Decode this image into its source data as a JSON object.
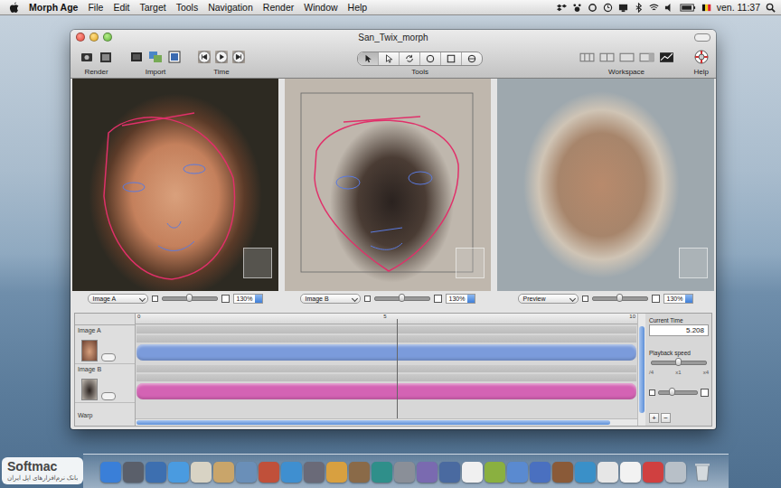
{
  "menubar": {
    "app": "Morph Age",
    "menus": [
      "File",
      "Edit",
      "Target",
      "Tools",
      "Navigation",
      "Render",
      "Window",
      "Help"
    ],
    "clock": "ven. 11:37"
  },
  "window": {
    "title": "San_Twix_morph"
  },
  "toolbar": {
    "labels": [
      "Render",
      "Import",
      "Time",
      "Tools",
      "Workspace",
      "Help"
    ],
    "tools": [
      {
        "kind": "select",
        "selected": true
      },
      {
        "kind": "direct",
        "selected": false
      },
      {
        "kind": "rotate",
        "selected": false
      },
      {
        "kind": "circle",
        "selected": false
      },
      {
        "kind": "square",
        "selected": false
      },
      {
        "kind": "morph",
        "selected": false
      }
    ]
  },
  "panes": [
    {
      "selector": "Image A",
      "zoom": "130%",
      "level": 0.5
    },
    {
      "selector": "Image B",
      "zoom": "130%",
      "level": 0.5
    },
    {
      "selector": "Preview",
      "zoom": "130%",
      "level": 0.5
    }
  ],
  "timeline": {
    "ruler": [
      "0",
      "5",
      "10"
    ],
    "playhead": 0.52,
    "tracks": [
      {
        "label": "Image A",
        "color": "#7b9bdb"
      },
      {
        "label": "Image B",
        "color": "#d463b4"
      }
    ],
    "extra_label": "Warp",
    "current_time_label": "Current Time",
    "current_time": "5.208",
    "speed_label": "Playback speed",
    "speed_marks": [
      "/4",
      "x1",
      "x4"
    ],
    "speed_level": 0.5,
    "zoom_level": 0.35,
    "add_button": "+",
    "remove_button": "−"
  },
  "watermark": {
    "brand": "Softmac",
    "tagline": "بانک نرم‌افزارهای اپل ایران"
  }
}
